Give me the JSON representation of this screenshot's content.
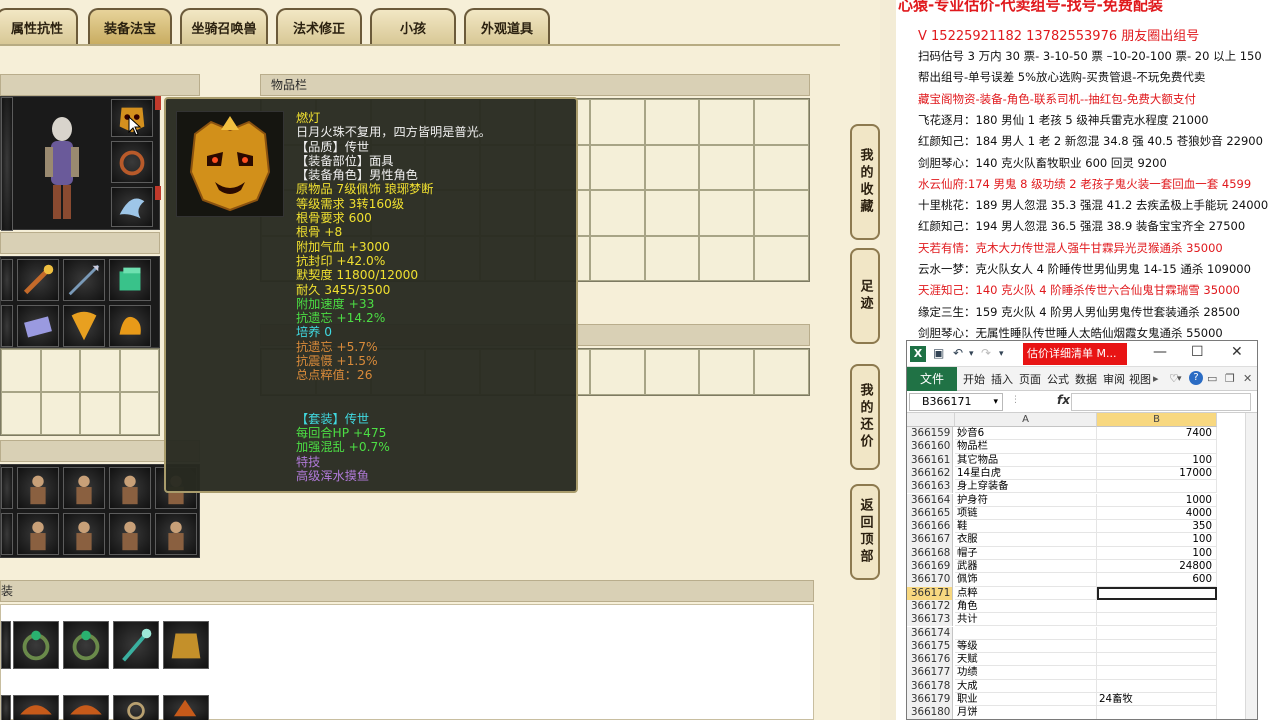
{
  "game": {
    "tabs": [
      {
        "label": "属性抗性"
      },
      {
        "label": "装备法宝"
      },
      {
        "label": "坐骑召唤兽"
      },
      {
        "label": "法术修正"
      },
      {
        "label": "小孩"
      },
      {
        "label": "外观道具"
      }
    ],
    "panel_items_title": "物品栏",
    "panel_bottom_fragment": "装",
    "side_buttons": [
      "我的收藏",
      "足迹",
      "我的还价",
      "返回顶部"
    ]
  },
  "tooltip": {
    "name": "燃灯",
    "desc": "日月火珠不复用，四方皆明是普光。",
    "quality": "【品质】传世",
    "part": "【装备部位】面具",
    "role": "【装备角色】男性角色",
    "origin": "原物品 7级佩饰 琅琊梦断",
    "level_req": "等级需求 3转160级",
    "bone_req": "根骨要求 600",
    "bone": "根骨 +8",
    "hp": "附加气血 +3000",
    "seal_res": "抗封印 +42.0%",
    "affinity": "默契度 11800/12000",
    "durability": "耐久 3455/3500",
    "speed": "附加速度 +33",
    "forget_res": "抗遗忘 +14.2%",
    "nurture": "培养 0",
    "forget_res2": "抗遗忘 +5.7%",
    "shock_res": "抗震慑 +1.5%",
    "total": "总点粹值：26",
    "set": "【套装】传世",
    "hp_regen": "每回合HP +475",
    "chaos": "加强混乱 +0.7%",
    "skill_label": "特技",
    "skill": "高级浑水摸鱼"
  },
  "ad": {
    "headline": "心猿-专业估价-代卖组号-找号-免费配装",
    "contact": "V 15225921182   13782553976 朋友圈出组号",
    "lines": [
      {
        "text": "扫码估号 3 万内 30 票- 3-10-50 票  –10-20-100 票- 20 以上 150",
        "red": false
      },
      {
        "text": "帮出组号-单号误差 5%放心选购-买贵管退-不玩免费代卖",
        "red": false
      },
      {
        "text": "藏宝阁物资-装备-角色-联系司机--抽红包-免费大额支付",
        "red": true
      },
      {
        "text": "飞花逐月：180 男仙 1 老孩 5 级神兵雷克水程度 21000",
        "red": false
      },
      {
        "text": "红颜知己：184 男人 1 老 2 新忽混 34.8 强 40.5 苍狼妙音 22900",
        "red": false
      },
      {
        "text": "剑胆琴心：140 克火队畜牧职业 600 回灵 9200",
        "red": false
      },
      {
        "text": "水云仙府:174 男鬼 8 级功绩 2 老孩子鬼火装一套回血一套 4599",
        "red": true
      },
      {
        "text": "十里桃花：189 男人忽混 35.3 强混 41.2 去疾孟极上手能玩 24000",
        "red": false
      },
      {
        "text": "红颜知己：194 男人忽混 36.5 强混 38.9 装备宝宝齐全 27500",
        "red": false
      },
      {
        "text": "天若有情：克木大力传世混人强牛甘霖异光灵猴通杀 35000",
        "red": true
      },
      {
        "text": "云水一梦：克火队女人 4 阶睡传世男仙男鬼 14-15 通杀 109000",
        "red": false
      },
      {
        "text": "天涯知己：140 克火队 4 阶睡杀传世六合仙鬼甘霖瑞雪 35000",
        "red": true
      },
      {
        "text": "缘定三生：159 克火队 4 阶男人男仙男鬼传世套装通杀 28500",
        "red": false
      },
      {
        "text": "剑胆琴心：无属性睡队传世睡人太皓仙烟霞女鬼通杀 55000",
        "red": false
      }
    ]
  },
  "excel": {
    "title": "估价详细清单 M...",
    "file_tab": "文件",
    "ribbon_tabs": [
      "开始",
      "插入",
      "页面",
      "公式",
      "数据",
      "审阅",
      "视图"
    ],
    "name_box": "B366171",
    "fx": "fx",
    "col_a": "A",
    "col_b": "B",
    "rows": [
      {
        "n": "366159",
        "a": "妙音6",
        "b": "7400"
      },
      {
        "n": "366160",
        "a": "物品栏",
        "b": ""
      },
      {
        "n": "366161",
        "a": "其它物品",
        "b": "100"
      },
      {
        "n": "366162",
        "a": "14星白虎",
        "b": "17000"
      },
      {
        "n": "366163",
        "a": "身上穿装备",
        "b": ""
      },
      {
        "n": "366164",
        "a": "护身符",
        "b": "1000"
      },
      {
        "n": "366165",
        "a": "项链",
        "b": "4000"
      },
      {
        "n": "366166",
        "a": "鞋",
        "b": "350"
      },
      {
        "n": "366167",
        "a": "衣服",
        "b": "100"
      },
      {
        "n": "366168",
        "a": "帽子",
        "b": "100"
      },
      {
        "n": "366169",
        "a": "武器",
        "b": "24800"
      },
      {
        "n": "366170",
        "a": "佩饰",
        "b": "600"
      },
      {
        "n": "366171",
        "a": "点粹",
        "b": ""
      },
      {
        "n": "366172",
        "a": "角色",
        "b": ""
      },
      {
        "n": "366173",
        "a": "共计",
        "b": ""
      },
      {
        "n": "366174",
        "a": "",
        "b": ""
      },
      {
        "n": "366175",
        "a": "等级",
        "b": ""
      },
      {
        "n": "366176",
        "a": "天赋",
        "b": ""
      },
      {
        "n": "366177",
        "a": "功绩",
        "b": ""
      },
      {
        "n": "366178",
        "a": "大成",
        "b": ""
      },
      {
        "n": "366179",
        "a": "职业",
        "b": "24畜牧"
      },
      {
        "n": "366180",
        "a": "月饼",
        "b": ""
      }
    ]
  }
}
